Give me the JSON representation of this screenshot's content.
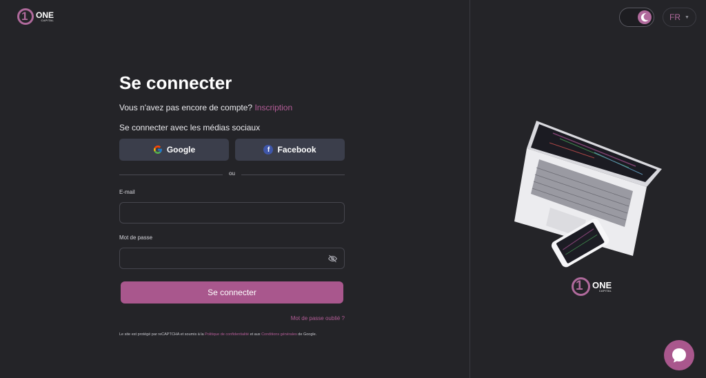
{
  "brand": {
    "name": "ONE",
    "sub": "CAPITAL",
    "mark": "1"
  },
  "login": {
    "title": "Se connecter",
    "no_account_text": "Vous n'avez pas encore de compte?",
    "signup_link": "Inscription",
    "social_label": "Se connecter avec les médias sociaux",
    "google_label": "Google",
    "facebook_label": "Facebook",
    "divider_text": "ou",
    "email_label": "E-mail",
    "email_value": "",
    "password_label": "Mot de passe",
    "password_value": "",
    "submit_label": "Se connecter",
    "forgot_link": "Mot de passe oublié ?",
    "legal_prefix": "Le site est protégé par reCAPTCHA et soumis à la",
    "privacy_link": "Politique de confidentialité",
    "legal_and": "et aux",
    "terms_link": "Conditions générales",
    "legal_suffix": "de Google."
  },
  "header": {
    "language": "FR",
    "theme": "dark"
  },
  "colors": {
    "accent": "#a9578d",
    "background": "#242428",
    "social_button": "#3b3e4b"
  }
}
